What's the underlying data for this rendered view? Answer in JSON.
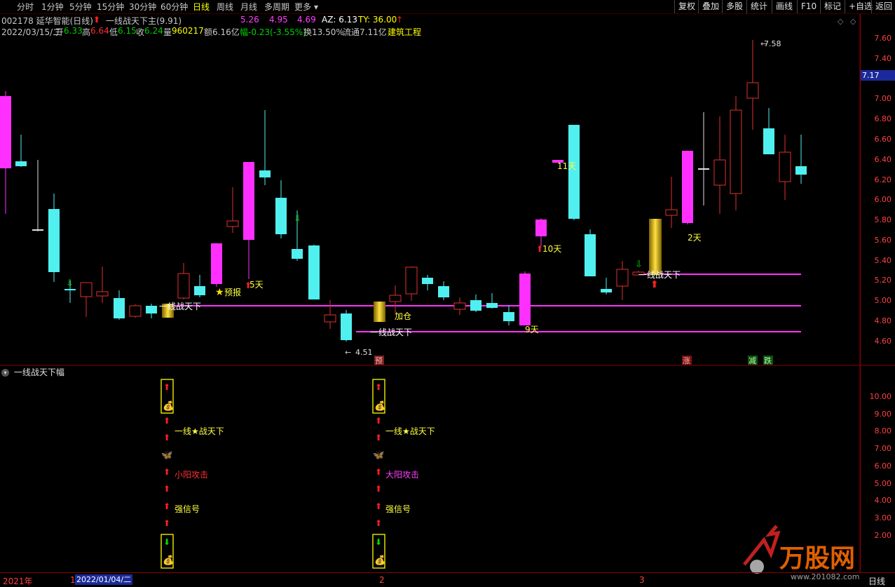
{
  "toolbar": {
    "periods": [
      "分时",
      "1分钟",
      "5分钟",
      "15分钟",
      "30分钟",
      "60分钟",
      "日线",
      "周线",
      "月线",
      "多周期",
      "更多"
    ],
    "active_period": "日线",
    "right_buttons": [
      "复权",
      "叠加",
      "多股",
      "统计",
      "画线",
      "F10",
      "标记",
      "+自选",
      "返回"
    ]
  },
  "header": {
    "code_name": "002178 延华智能(日线)",
    "indicator_name": "一线战天下主(9.91)",
    "val1": "5.26",
    "val2": "4.95",
    "val3": "4.69",
    "az": "AZ: 6.13",
    "ty": "TY: 36.00",
    "date": "2022/03/15/二",
    "open_label": "开",
    "open": "6.33",
    "high_label": "高",
    "high": "6.64",
    "low_label": "低",
    "low": "6.15",
    "close_label": "收",
    "close": "6.24",
    "vol_label": "量",
    "vol": "960217",
    "amount": "额6.16亿",
    "change": "幅-0.23(-3.55%)",
    "turnover": "换13.50%",
    "float_cap": "流通7.11亿",
    "sector": "建筑工程"
  },
  "price_axis": {
    "ticks": [
      "7.60",
      "7.40",
      "7.20",
      "7.00",
      "6.80",
      "6.60",
      "6.40",
      "6.20",
      "6.00",
      "5.80",
      "5.60",
      "5.40",
      "5.20",
      "5.00",
      "4.80",
      "4.60"
    ],
    "current": "7.17"
  },
  "sub_panel": {
    "title": "一线战天下幅",
    "ticks": [
      "10.00",
      "9.00",
      "8.00",
      "7.00",
      "6.00",
      "5.00",
      "4.00",
      "3.00",
      "2.00"
    ],
    "labels_left": {
      "line_star": "一线★战天下",
      "attack": "小阳攻击",
      "strong": "强信号"
    },
    "labels_right": {
      "line_star": "一线★战天下",
      "attack": "大阳攻击",
      "strong": "强信号"
    }
  },
  "chart_labels": {
    "high_mark": "7.58",
    "low_mark": "4.51",
    "line1": "一线战天下",
    "line2": "一线战天下",
    "line3": "一线战天下",
    "add_pos": "加仓",
    "forecast": "预报",
    "days5": "5天",
    "days9": "9天",
    "days10": "10天",
    "days11": "11天",
    "days2": "2天",
    "tag_yu": "预",
    "tag_zhang": "涨",
    "tag_jian": "减",
    "tag_die": "跌"
  },
  "date_bar": {
    "year": "2021年",
    "m1": "1",
    "cursor_date": "2022/01/04/二",
    "m2": "2",
    "m3": "3",
    "period": "日线"
  },
  "watermark": {
    "brand": "万股网",
    "url": "www.201082.com"
  }
}
